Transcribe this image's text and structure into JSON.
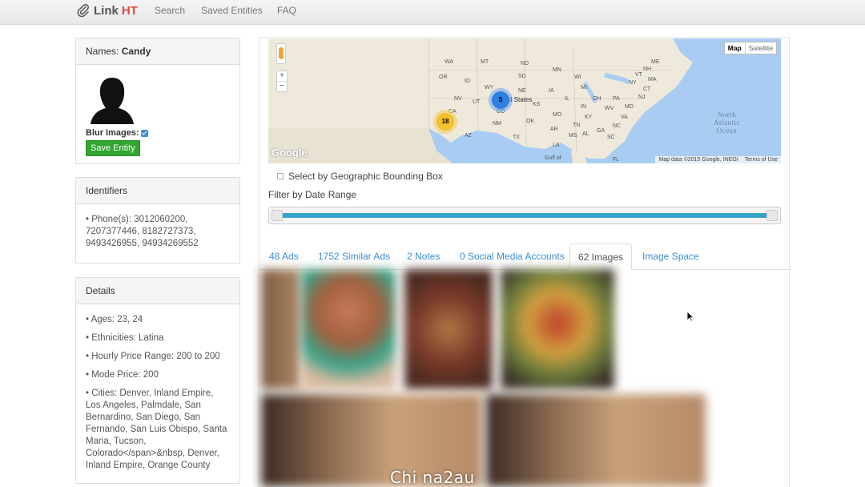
{
  "navbar": {
    "brand_main": "Link",
    "brand_accent": "HT",
    "links": [
      "Search",
      "Saved Entities",
      "FAQ"
    ]
  },
  "entity": {
    "names_label": "Names:",
    "name": "Candy",
    "blur_label": "Blur Images:",
    "blur_checked": true,
    "save_label": "Save Entity"
  },
  "identifiers": {
    "title": "Identifiers",
    "phones": "• Phone(s): 3012060200, 7207377446, 8182727373, 9493426955, 94934269552"
  },
  "details": {
    "title": "Details",
    "ages": "• Ages: 23, 24",
    "ethnicities": "• Ethnicities: Latina",
    "price_range": "• Hourly Price Range: 200 to 200",
    "mode_price": "• Mode Price: 200",
    "cities": "• Cities: Denver, Inland Empire, Los Angeles, Palmdale, San Bernardino, San Diego, San Fernando, San Luis Obispo, Santa Maria, Tucson, Colorado</span>&nbsp, Denver, Inland Empire, Orange County"
  },
  "map": {
    "type_map": "Map",
    "type_satellite": "Satellite",
    "zoom_in": "+",
    "zoom_out": "−",
    "cluster_blue": "5",
    "cluster_yellow": "18",
    "country_label": "d States",
    "ocean_label": "North\nAtlantic\nOcean",
    "gulf_label": "Gulf of",
    "google_logo": "Google",
    "map_data": "Map data ©2015 Google, INEGI",
    "terms": "Terms of Use",
    "state_labels": [
      "WA",
      "MT",
      "ND",
      "MN",
      "OR",
      "ID",
      "SD",
      "WI",
      "WY",
      "NE",
      "IA",
      "NV",
      "UT",
      "CO",
      "KS",
      "MO",
      "CA",
      "AZ",
      "NM",
      "OK",
      "AR",
      "TX",
      "LA",
      "MS",
      "AL",
      "GA",
      "TN",
      "KY",
      "IL",
      "IN",
      "OH",
      "MI",
      "PA",
      "NY",
      "VA",
      "NC",
      "SC",
      "FL",
      "WV",
      "MD",
      "NJ",
      "VT",
      "NH",
      "ME",
      "MA",
      "CT"
    ],
    "colors": {
      "water": "#a9cdf2",
      "land": "#efe9dc",
      "cluster_blue": "#2f7fe0",
      "cluster_yellow": "#f1c12e"
    }
  },
  "filters": {
    "bbox_label": "Select by Geographic Bounding Box",
    "date_label": "Filter by Date Range",
    "date_range_fraction": [
      0.0,
      1.0
    ]
  },
  "tabs": {
    "ads": "48 Ads",
    "similar": "1752 Similar Ads",
    "notes": "2 Notes",
    "social": "0 Social Media Accounts",
    "images": "62 Images",
    "image_space": "Image Space",
    "active": "62 Images"
  },
  "images": [
    "blurred-image-1",
    "blurred-image-2",
    "blurred-image-3",
    "blurred-image-4",
    "blurred-image-5",
    "blurred-image-6"
  ],
  "watermark": "Chi na2au"
}
